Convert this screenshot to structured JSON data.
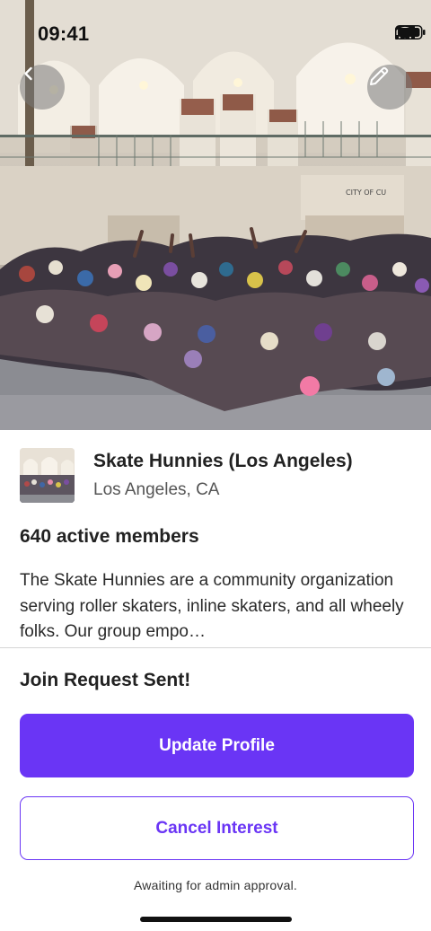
{
  "status_bar": {
    "time": "09:41",
    "icons": [
      "cellular-signal-icon",
      "wifi-icon",
      "battery-icon"
    ]
  },
  "hero": {
    "image_description_name": "group-cover-photo",
    "back_icon": "chevron-left-icon",
    "edit_icon": "pencil-icon"
  },
  "group": {
    "name": "Skate Hunnies (Los Angeles)",
    "location": "Los Angeles, CA",
    "members": "640 active members",
    "description": "The Skate Hunnies are a community organization serving roller skaters, inline skaters, and all wheely folks. Our group empo…"
  },
  "join": {
    "status_title": "Join Request Sent!",
    "update_profile_label": "Update Profile",
    "cancel_interest_label": "Cancel Interest",
    "note": "Awaiting for admin approval."
  },
  "colors": {
    "accent": "#6a35f5",
    "text": "#222222",
    "muted": "#555555"
  }
}
